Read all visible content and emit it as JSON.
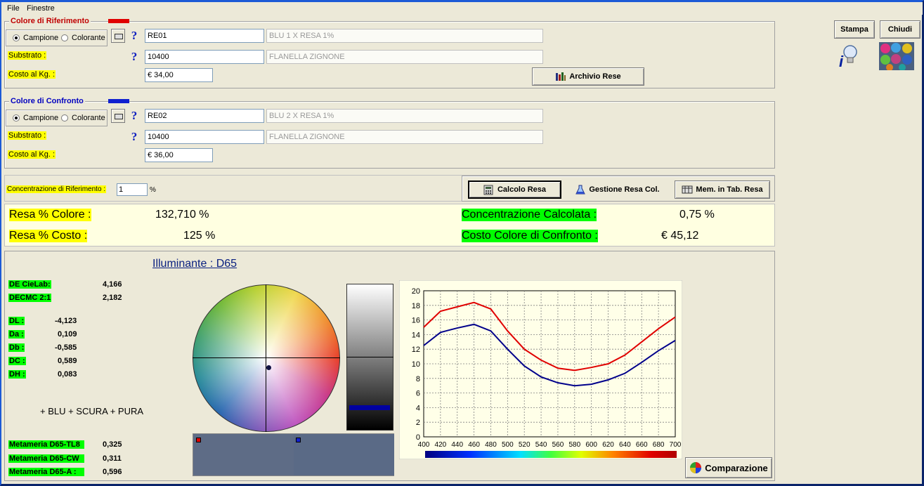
{
  "menu": [
    "File",
    "Finestre"
  ],
  "riferimento": {
    "title": "Colore di Riferimento",
    "swatch_color": "#e00000",
    "radio_campione": "Campione",
    "radio_colorante": "Colorante",
    "code": "RE01",
    "desc": "BLU 1 X RESA 1%",
    "substrato_label": "Substrato :",
    "substrato_code": "10400",
    "substrato_desc": "FLANELLA ZIGNONE",
    "costo_label": "Costo al Kg. :",
    "costo": "€ 34,00"
  },
  "confronto": {
    "title": "Colore di Confronto",
    "swatch_color": "#1020d0",
    "radio_campione": "Campione",
    "radio_colorante": "Colorante",
    "code": "RE02",
    "desc": "BLU 2 X RESA 1%",
    "substrato_label": "Substrato :",
    "substrato_code": "10400",
    "substrato_desc": "FLANELLA ZIGNONE",
    "costo_label": "Costo al Kg. :",
    "costo": "€ 36,00"
  },
  "buttons": {
    "archivio": "Archivio Rese",
    "stampa": "Stampa",
    "chiudi": "Chiudi",
    "calcolo": "Calcolo Resa",
    "gestione": "Gestione Resa Col.",
    "mem": "Mem. in Tab. Resa",
    "comparazione": "Comparazione"
  },
  "concentrazione": {
    "label": "Concentrazione di Riferimento :",
    "value": "1",
    "unit": "%"
  },
  "results": {
    "resa_colore_label": "Resa % Colore :",
    "resa_colore_value": "132,710  %",
    "resa_costo_label": "Resa % Costo :",
    "resa_costo_value": "125  %",
    "conc_calc_label": "Concentrazione Calcolata :",
    "conc_calc_value": "0,75  %",
    "costo_confronto_label": "Costo Colore di Confronto :",
    "costo_confronto_value": "€ 45,12"
  },
  "illuminante": "Illuminante : D65",
  "metrics": [
    {
      "label": "DE CieLab:",
      "value": "4,166"
    },
    {
      "label": "DECMC 2:1",
      "value": "2,182"
    },
    {
      "label": "DL :",
      "value": "-4,123"
    },
    {
      "label": "Da :",
      "value": "0,109"
    },
    {
      "label": "Db :",
      "value": "-0,585"
    },
    {
      "label": "DC :",
      "value": "0,589"
    },
    {
      "label": "DH :",
      "value": "0,083"
    }
  ],
  "description": "+ BLU + SCURA + PURA",
  "metameria": [
    {
      "label": "Metameria D65-TL8",
      "value": "0,325"
    },
    {
      "label": "Metameria D65-CW",
      "value": "0,311"
    },
    {
      "label": "Metameria D65-A :",
      "value": "0,596"
    }
  ],
  "chart_data": {
    "type": "line",
    "x": [
      400,
      420,
      440,
      460,
      480,
      500,
      520,
      540,
      560,
      580,
      600,
      620,
      640,
      660,
      680,
      700
    ],
    "series": [
      {
        "color": "#e00000",
        "values": [
          15.0,
          17.2,
          17.8,
          18.4,
          17.5,
          14.5,
          12.0,
          10.5,
          9.4,
          9.1,
          9.5,
          10.0,
          11.2,
          13.0,
          14.8,
          16.4
        ]
      },
      {
        "color": "#00008b",
        "values": [
          12.5,
          14.3,
          14.9,
          15.4,
          14.5,
          12.0,
          9.7,
          8.2,
          7.4,
          7.0,
          7.2,
          7.8,
          8.7,
          10.2,
          11.8,
          13.2
        ]
      }
    ],
    "ylim": [
      0,
      20
    ],
    "yticks": [
      0,
      2,
      4,
      6,
      8,
      10,
      12,
      14,
      16,
      18,
      20
    ],
    "xticks": [
      400,
      420,
      440,
      460,
      480,
      500,
      520,
      540,
      560,
      580,
      600,
      620,
      640,
      660,
      680,
      700
    ],
    "grid": true
  }
}
